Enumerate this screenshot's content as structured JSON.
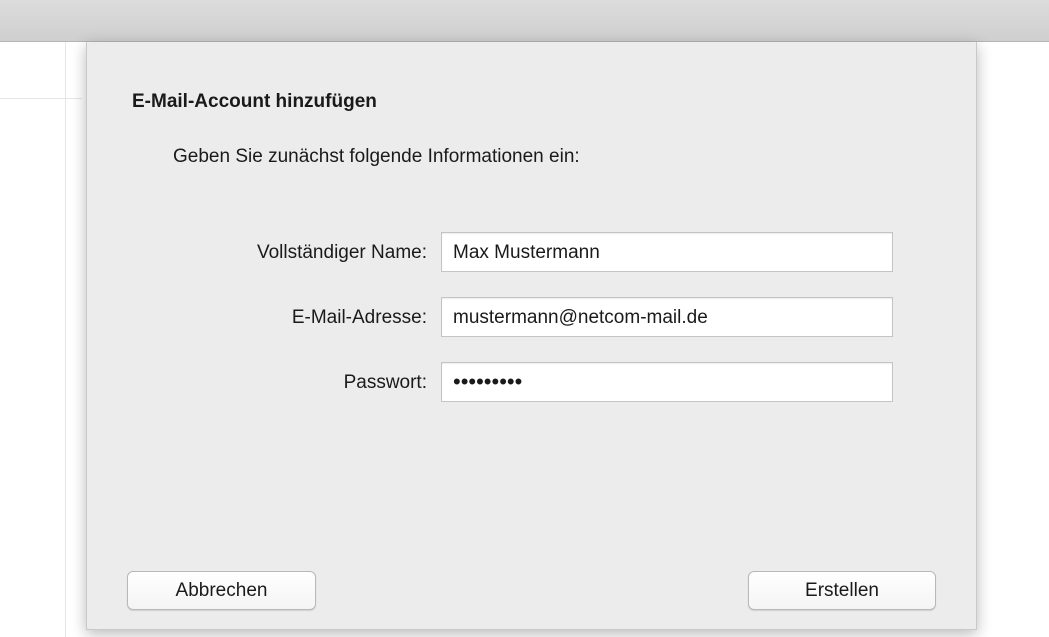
{
  "dialog": {
    "title": "E-Mail-Account hinzufügen",
    "intro": "Geben Sie zunächst folgende Informationen ein:",
    "fields": [
      {
        "label": "Vollständiger Name:",
        "value": "Max Mustermann"
      },
      {
        "label": "E-Mail-Adresse:",
        "value": "mustermann@netcom-mail.de"
      },
      {
        "label": "Passwort:",
        "value": "•••••••••"
      }
    ],
    "cancel_label": "Abbrechen",
    "create_label": "Erstellen"
  }
}
